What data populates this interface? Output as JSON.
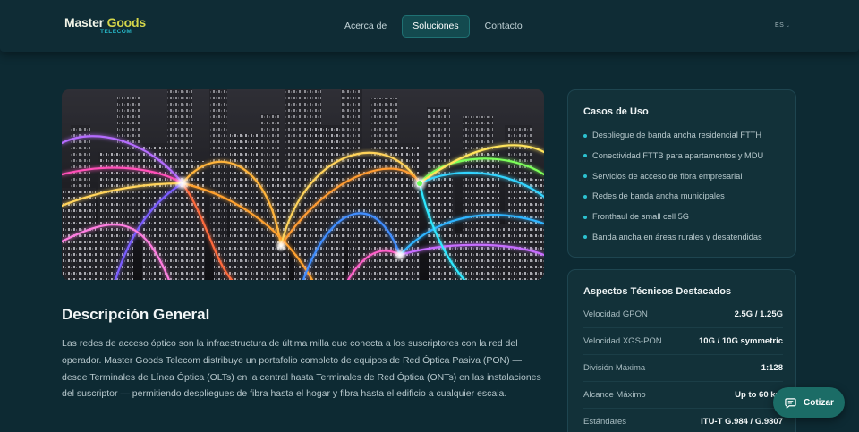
{
  "brand": {
    "name_part1": "Master ",
    "name_part2": "Goods",
    "sub": "TELECOM"
  },
  "nav": {
    "items": [
      "Acerca de",
      "Soluciones",
      "Contacto"
    ],
    "active": "Soluciones"
  },
  "language": {
    "code": "ES"
  },
  "hero": {
    "image": "city-fiber-network-illustration"
  },
  "overview": {
    "title": "Descripción General",
    "text": "Las redes de acceso óptico son la infraestructura de última milla que conecta a los suscriptores con la red del operador. Master Goods Telecom distribuye un portafolio completo de equipos de Red Óptica Pasiva (PON) — desde Terminales de Línea Óptica (OLTs) en la central hasta Terminales de Red Óptica (ONTs) en las instalaciones del suscriptor — permitiendo despliegues de fibra hasta el hogar y fibra hasta el edificio a cualquier escala."
  },
  "use_cases": {
    "title": "Casos de Uso",
    "items": [
      "Despliegue de banda ancha residencial FTTH",
      "Conectividad FTTB para apartamentos y MDU",
      "Servicios de acceso de fibra empresarial",
      "Redes de banda ancha municipales",
      "Fronthaul de small cell 5G",
      "Banda ancha en áreas rurales y desatendidas"
    ]
  },
  "tech": {
    "title": "Aspectos Técnicos Destacados",
    "rows": [
      {
        "label": "Velocidad GPON",
        "value": "2.5G / 1.25G"
      },
      {
        "label": "Velocidad XGS-PON",
        "value": "10G / 10G symmetric"
      },
      {
        "label": "División Máxima",
        "value": "1:128"
      },
      {
        "label": "Alcance Máximo",
        "value": "Up to 60 km"
      },
      {
        "label": "Estándares",
        "value": "ITU-T G.984 / G.9807"
      }
    ]
  },
  "quote_button": {
    "label": "Cotizar"
  },
  "colors": {
    "background": "#0d2a33",
    "accent": "#2bc1cf",
    "brand_yellow": "#d4d64a",
    "button": "#1b6c66"
  }
}
